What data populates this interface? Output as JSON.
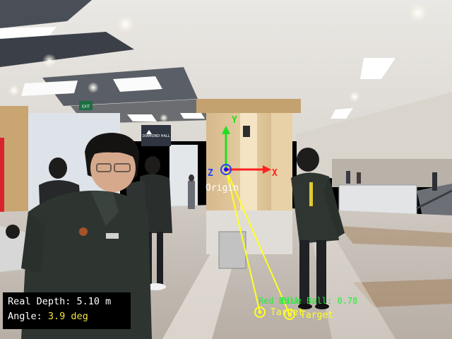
{
  "overlay": {
    "axis_labels": {
      "z": "Z",
      "y": "Y",
      "x": "X"
    },
    "origin_label": "Origin",
    "targets": [
      {
        "label": "Target",
        "caption": "Red Ball"
      },
      {
        "label": "Target",
        "caption": "Blue Ball: 0.78"
      }
    ],
    "colors": {
      "x_axis": "#ff2020",
      "y_axis": "#20e020",
      "z_axis": "#2040ff",
      "target_line": "#ffff20",
      "target_caption": "#22ee33",
      "readout_value": "#f3e23a"
    }
  },
  "readout": {
    "depth_label": "Real Depth:",
    "depth_value": "5.10 m",
    "angle_label": "Angle:",
    "angle_value": "3.9 deg"
  },
  "scene": {
    "sign_text": "DIAMOND HALL",
    "exit_sign": "EXIT"
  }
}
